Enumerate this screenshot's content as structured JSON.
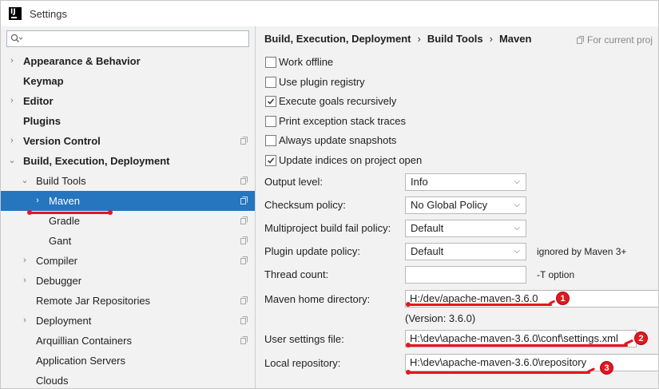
{
  "window": {
    "title": "Settings"
  },
  "sidebar": {
    "search_placeholder": "",
    "items": [
      {
        "label": "Appearance & Behavior",
        "bold": true,
        "arrow": "›",
        "indent": 0
      },
      {
        "label": "Keymap",
        "bold": true,
        "arrow": "",
        "indent": 0
      },
      {
        "label": "Editor",
        "bold": true,
        "arrow": "›",
        "indent": 0
      },
      {
        "label": "Plugins",
        "bold": true,
        "arrow": "",
        "indent": 0
      },
      {
        "label": "Version Control",
        "bold": true,
        "arrow": "›",
        "indent": 0,
        "project": true
      },
      {
        "label": "Build, Execution, Deployment",
        "bold": true,
        "arrow": "⌄",
        "indent": 0
      },
      {
        "label": "Build Tools",
        "bold": false,
        "arrow": "⌄",
        "indent": 1,
        "project": true
      },
      {
        "label": "Maven",
        "bold": false,
        "arrow": "›",
        "indent": 2,
        "project": true,
        "selected": true
      },
      {
        "label": "Gradle",
        "bold": false,
        "arrow": "",
        "indent": 2,
        "project": true
      },
      {
        "label": "Gant",
        "bold": false,
        "arrow": "",
        "indent": 2,
        "project": true
      },
      {
        "label": "Compiler",
        "bold": false,
        "arrow": "›",
        "indent": 1,
        "project": true
      },
      {
        "label": "Debugger",
        "bold": false,
        "arrow": "›",
        "indent": 1
      },
      {
        "label": "Remote Jar Repositories",
        "bold": false,
        "arrow": "",
        "indent": 1,
        "project": true
      },
      {
        "label": "Deployment",
        "bold": false,
        "arrow": "›",
        "indent": 1,
        "project": true
      },
      {
        "label": "Arquillian Containers",
        "bold": false,
        "arrow": "",
        "indent": 1,
        "project": true
      },
      {
        "label": "Application Servers",
        "bold": false,
        "arrow": "",
        "indent": 1
      },
      {
        "label": "Clouds",
        "bold": false,
        "arrow": "",
        "indent": 1
      }
    ]
  },
  "breadcrumb": [
    "Build, Execution, Deployment",
    "Build Tools",
    "Maven"
  ],
  "breadcrumb_sep": "›",
  "for_current_project": "For current proj",
  "checkboxes": [
    {
      "label": "Work offline",
      "checked": false
    },
    {
      "label": "Use plugin registry",
      "checked": false
    },
    {
      "label": "Execute goals recursively",
      "checked": true
    },
    {
      "label": "Print exception stack traces",
      "checked": false
    },
    {
      "label": "Always update snapshots",
      "checked": false
    },
    {
      "label": "Update indices on project open",
      "checked": true
    }
  ],
  "form": {
    "output_level": {
      "label": "Output level:",
      "value": "Info"
    },
    "checksum_policy": {
      "label": "Checksum policy:",
      "value": "No Global Policy"
    },
    "multiproject_fail_policy": {
      "label": "Multiproject build fail policy:",
      "value": "Default"
    },
    "plugin_update_policy": {
      "label": "Plugin update policy:",
      "value": "Default",
      "hint": "ignored by Maven 3+"
    },
    "thread_count": {
      "label": "Thread count:",
      "value": "",
      "hint": "-T option"
    },
    "maven_home": {
      "label": "Maven home directory:",
      "value": "H:/dev/apache-maven-3.6.0",
      "version": "(Version: 3.6.0)"
    },
    "user_settings": {
      "label": "User settings file:",
      "value": "H:\\dev\\apache-maven-3.6.0\\conf\\settings.xml"
    },
    "local_repo": {
      "label": "Local repository:",
      "value": "H:\\dev\\apache-maven-3.6.0\\repository"
    }
  },
  "annotations": [
    "1",
    "2",
    "3"
  ],
  "colors": {
    "selection": "#2675bf",
    "annotation_red": "#e8141e"
  }
}
